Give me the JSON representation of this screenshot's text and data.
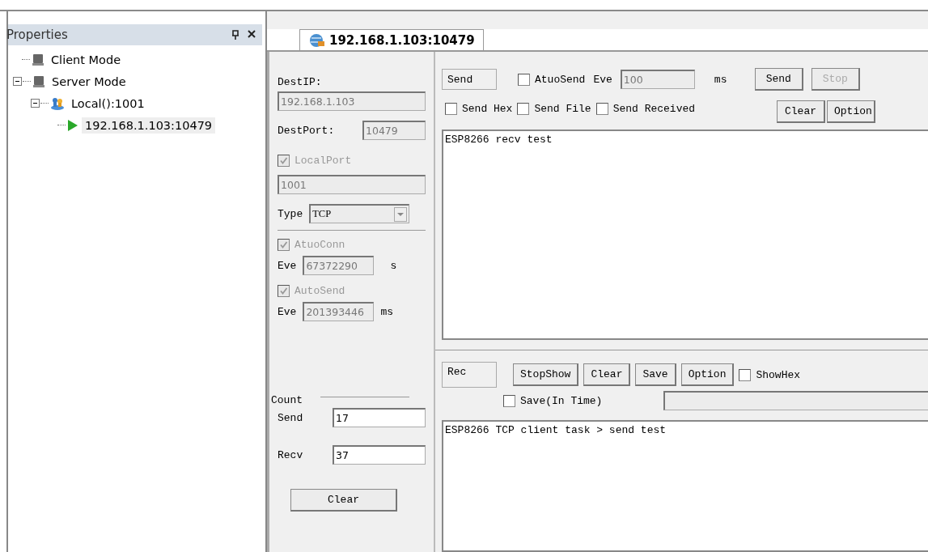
{
  "properties": {
    "title": "Properties",
    "tree": [
      {
        "label": "Client Mode",
        "kind": "computer",
        "selected": false
      },
      {
        "label": "Server Mode",
        "kind": "computer",
        "expanded": true,
        "selected": false,
        "children": [
          {
            "label": "Local():1001",
            "kind": "group",
            "expanded": true,
            "selected": false,
            "children": [
              {
                "label": "192.168.1.103:10479",
                "kind": "connection",
                "selected": true
              }
            ]
          }
        ]
      }
    ]
  },
  "tab": {
    "label": "192.168.1.103:10479",
    "selected": true
  },
  "settings": {
    "dest_ip_label": "DestIP:",
    "dest_ip": "192.168.1.103",
    "dest_port_label": "DestPort:",
    "dest_port": "10479",
    "local_port": {
      "label": "LocalPort",
      "checked": true,
      "disabled": true
    },
    "local_port_value": "1001",
    "type_label": "Type",
    "type": "TCP",
    "auto_conn": {
      "label": "AtuoConn",
      "checked": true,
      "disabled": true
    },
    "conn_eve_label": "Eve",
    "conn_eve": "67372290",
    "conn_unit": "s",
    "auto_send": {
      "label": "AutoSend",
      "checked": true,
      "disabled": true
    },
    "send_eve_label": "Eve",
    "send_eve": "201393446",
    "send_unit": "ms"
  },
  "count": {
    "title": "Count",
    "send_label": "Send",
    "send": "17",
    "recv_label": "Recv",
    "recv": "37",
    "clear": "Clear"
  },
  "send_panel": {
    "label": "Send",
    "auto_send": {
      "label": "AtuoSend",
      "checked": false,
      "disabled": false
    },
    "eve_label": "Eve",
    "eve": "100",
    "unit": "ms",
    "buttons": [
      {
        "label": "Send",
        "disabled": false
      },
      {
        "label": "Stop",
        "disabled": true
      }
    ],
    "options": [
      {
        "label": "Send Hex",
        "checked": false
      },
      {
        "label": "Send File",
        "checked": false
      },
      {
        "label": "Send Received",
        "checked": false
      }
    ],
    "buttons2": [
      {
        "label": "Clear",
        "disabled": false
      },
      {
        "label": "Option",
        "disabled": false
      }
    ],
    "text": "ESP8266 recv test"
  },
  "recv_panel": {
    "label": "Rec",
    "buttons": [
      {
        "label": "StopShow",
        "disabled": false
      },
      {
        "label": "Clear",
        "disabled": false
      },
      {
        "label": "Save",
        "disabled": false
      },
      {
        "label": "Option",
        "disabled": false
      }
    ],
    "show_hex": {
      "label": "ShowHex",
      "checked": false
    },
    "save_in_time": {
      "label": "Save(In Time)",
      "checked": false
    },
    "text": "ESP8266 TCP client task > send test"
  }
}
